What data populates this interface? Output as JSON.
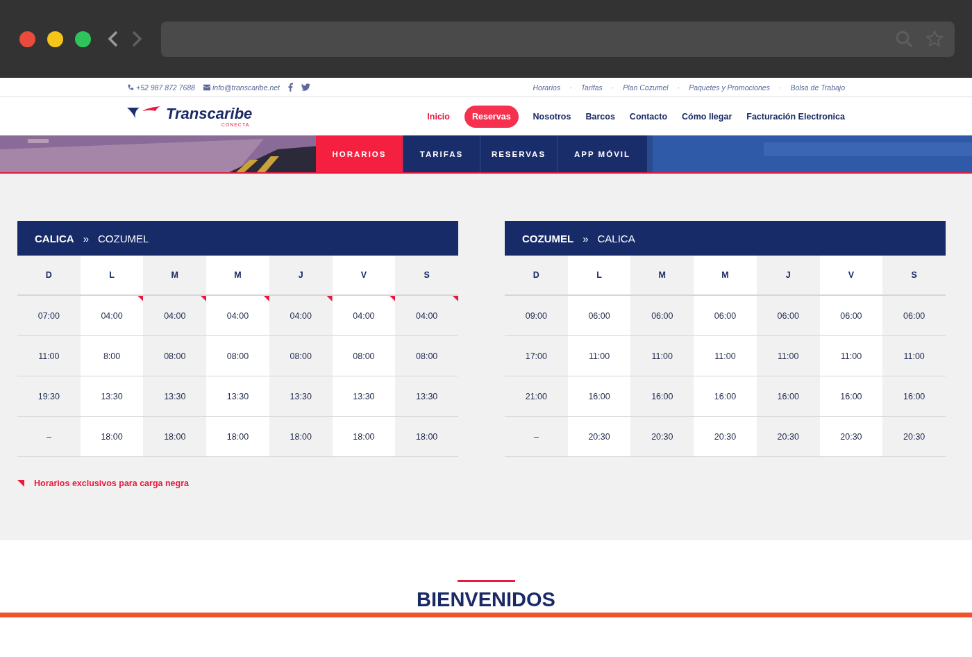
{
  "topbar": {
    "phone": "+52 987 872 7688",
    "email": "info@transcaribe.net",
    "separator": "·",
    "links": [
      "Horarios",
      "Tarifas",
      "Plan Cozumel",
      "Paquetes y Promociones",
      "Bolsa de Trabajo"
    ]
  },
  "logo": {
    "name": "Transcaribe",
    "tagline": "CONECTA"
  },
  "nav": [
    {
      "label": "Inicio",
      "selected": true,
      "kind": "link"
    },
    {
      "label": "Reservas",
      "selected": false,
      "kind": "pill"
    },
    {
      "label": "Nosotros",
      "selected": false,
      "kind": "link"
    },
    {
      "label": "Barcos",
      "selected": false,
      "kind": "link"
    },
    {
      "label": "Contacto",
      "selected": false,
      "kind": "link"
    },
    {
      "label": "Cómo llegar",
      "selected": false,
      "kind": "link"
    },
    {
      "label": "Facturación Electronica",
      "selected": false,
      "kind": "link"
    }
  ],
  "subtabs": [
    {
      "label": "HORARIOS",
      "selected": true
    },
    {
      "label": "TARIFAS",
      "selected": false
    },
    {
      "label": "RESERVAS",
      "selected": false
    },
    {
      "label": "APP MÓVIL",
      "selected": false
    }
  ],
  "schedules": [
    {
      "origin": "CALICA",
      "separator": "»",
      "destination": "COZUMEL",
      "days": [
        "D",
        "L",
        "M",
        "M",
        "J",
        "V",
        "S"
      ],
      "rows": [
        [
          {
            "time": "07:00",
            "cargo": false
          },
          {
            "time": "04:00",
            "cargo": true
          },
          {
            "time": "04:00",
            "cargo": true
          },
          {
            "time": "04:00",
            "cargo": true
          },
          {
            "time": "04:00",
            "cargo": true
          },
          {
            "time": "04:00",
            "cargo": true
          },
          {
            "time": "04:00",
            "cargo": true
          }
        ],
        [
          {
            "time": "11:00",
            "cargo": false
          },
          {
            "time": "8:00",
            "cargo": false
          },
          {
            "time": "08:00",
            "cargo": false
          },
          {
            "time": "08:00",
            "cargo": false
          },
          {
            "time": "08:00",
            "cargo": false
          },
          {
            "time": "08:00",
            "cargo": false
          },
          {
            "time": "08:00",
            "cargo": false
          }
        ],
        [
          {
            "time": "19:30",
            "cargo": false
          },
          {
            "time": "13:30",
            "cargo": false
          },
          {
            "time": "13:30",
            "cargo": false
          },
          {
            "time": "13:30",
            "cargo": false
          },
          {
            "time": "13:30",
            "cargo": false
          },
          {
            "time": "13:30",
            "cargo": false
          },
          {
            "time": "13:30",
            "cargo": false
          }
        ],
        [
          {
            "time": "–",
            "cargo": false
          },
          {
            "time": "18:00",
            "cargo": false
          },
          {
            "time": "18:00",
            "cargo": false
          },
          {
            "time": "18:00",
            "cargo": false
          },
          {
            "time": "18:00",
            "cargo": false
          },
          {
            "time": "18:00",
            "cargo": false
          },
          {
            "time": "18:00",
            "cargo": false
          }
        ]
      ]
    },
    {
      "origin": "COZUMEL",
      "separator": "»",
      "destination": "CALICA",
      "days": [
        "D",
        "L",
        "M",
        "M",
        "J",
        "V",
        "S"
      ],
      "rows": [
        [
          {
            "time": "09:00",
            "cargo": false
          },
          {
            "time": "06:00",
            "cargo": false
          },
          {
            "time": "06:00",
            "cargo": false
          },
          {
            "time": "06:00",
            "cargo": false
          },
          {
            "time": "06:00",
            "cargo": false
          },
          {
            "time": "06:00",
            "cargo": false
          },
          {
            "time": "06:00",
            "cargo": false
          }
        ],
        [
          {
            "time": "17:00",
            "cargo": false
          },
          {
            "time": "11:00",
            "cargo": false
          },
          {
            "time": "11:00",
            "cargo": false
          },
          {
            "time": "11:00",
            "cargo": false
          },
          {
            "time": "11:00",
            "cargo": false
          },
          {
            "time": "11:00",
            "cargo": false
          },
          {
            "time": "11:00",
            "cargo": false
          }
        ],
        [
          {
            "time": "21:00",
            "cargo": false
          },
          {
            "time": "16:00",
            "cargo": false
          },
          {
            "time": "16:00",
            "cargo": false
          },
          {
            "time": "16:00",
            "cargo": false
          },
          {
            "time": "16:00",
            "cargo": false
          },
          {
            "time": "16:00",
            "cargo": false
          },
          {
            "time": "16:00",
            "cargo": false
          }
        ],
        [
          {
            "time": "–",
            "cargo": false
          },
          {
            "time": "20:30",
            "cargo": false
          },
          {
            "time": "20:30",
            "cargo": false
          },
          {
            "time": "20:30",
            "cargo": false
          },
          {
            "time": "20:30",
            "cargo": false
          },
          {
            "time": "20:30",
            "cargo": false
          },
          {
            "time": "20:30",
            "cargo": false
          }
        ]
      ]
    }
  ],
  "legend": "Horarios exclusivos para carga negra",
  "welcome": {
    "title": "BIENVENIDOS"
  }
}
